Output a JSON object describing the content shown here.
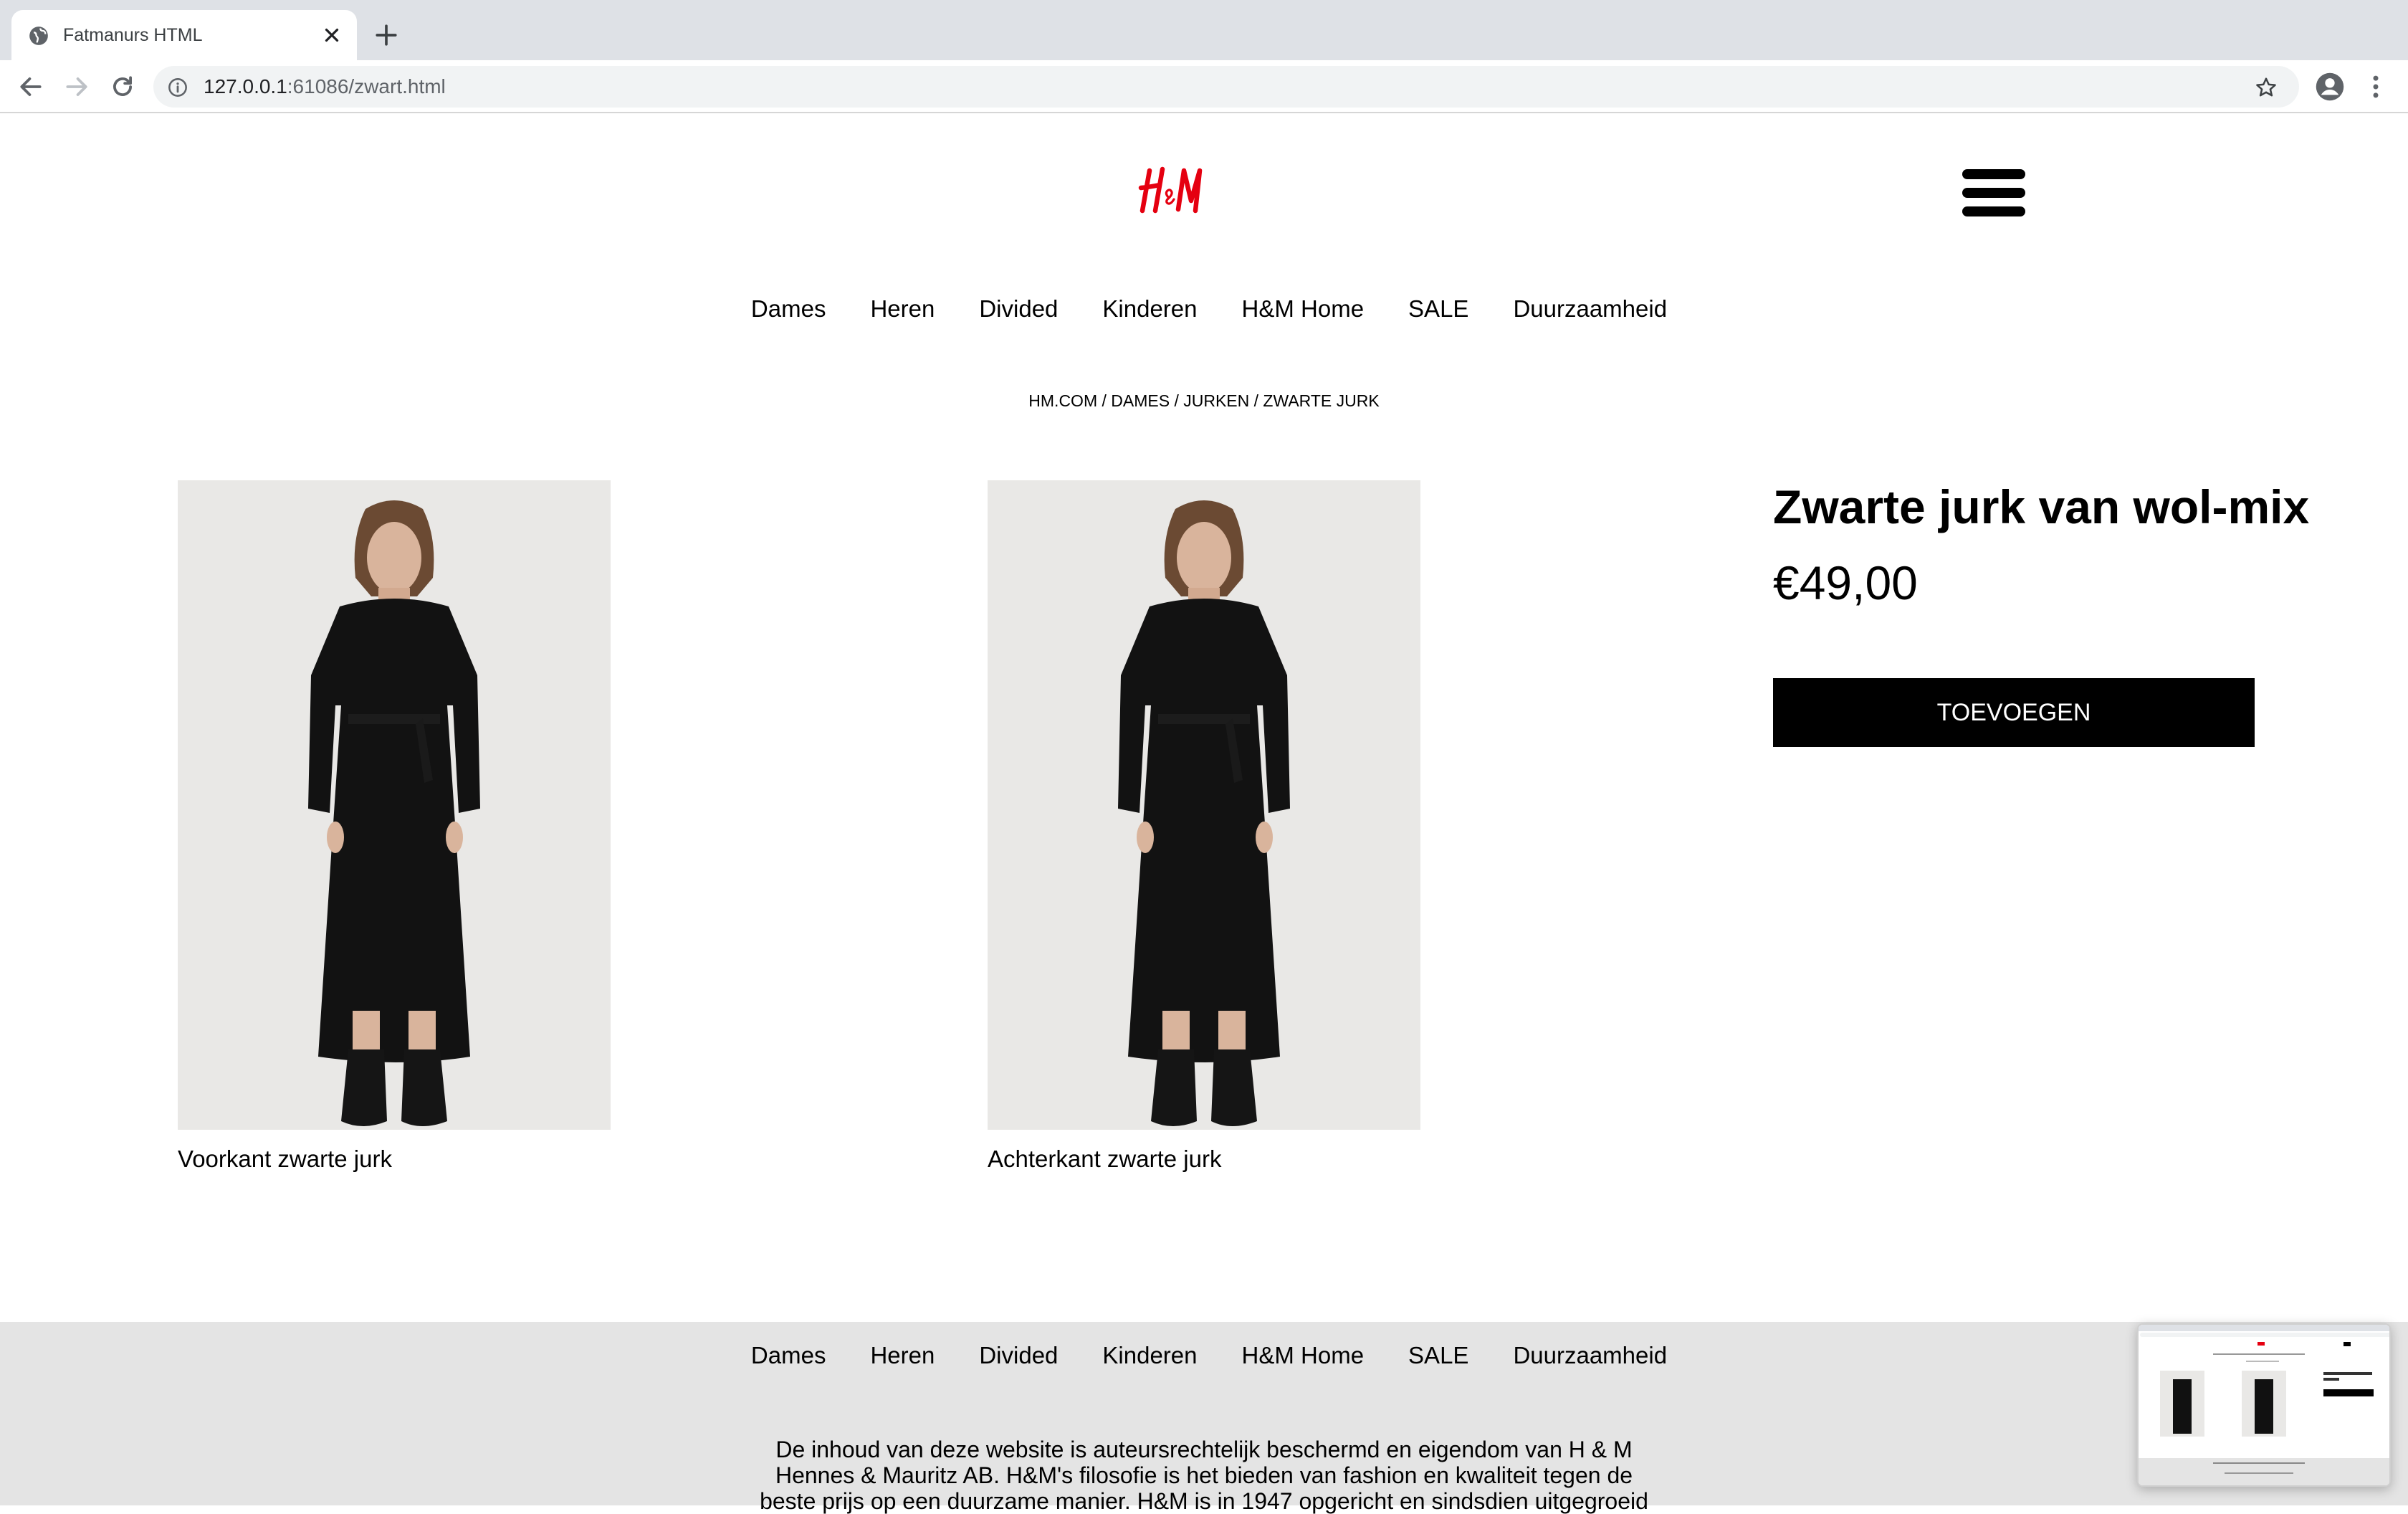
{
  "browser": {
    "tab_title": "Fatmanurs HTML",
    "url_host": "127.0.0.1",
    "url_rest": ":61086/zwart.html"
  },
  "header": {
    "logo_text": "H&M",
    "logo_color": "#e50010"
  },
  "nav": [
    "Dames",
    "Heren",
    "Divided",
    "Kinderen",
    "H&M Home",
    "SALE",
    "Duurzaamheid"
  ],
  "breadcrumb": "HM.COM / DAMES / JURKEN / ZWARTE JURK",
  "gallery": [
    {
      "caption": "Voorkant zwarte jurk"
    },
    {
      "caption": "Achterkant zwarte jurk"
    }
  ],
  "product": {
    "title": "Zwarte jurk van wol-mix",
    "price": "€49,00",
    "add_button": "TOEVOEGEN"
  },
  "footer": {
    "nav": [
      "Dames",
      "Heren",
      "Divided",
      "Kinderen",
      "H&M Home",
      "SALE",
      "Duurzaamheid"
    ],
    "text": "De inhoud van deze website is auteursrechtelijk beschermd en eigendom van H & M Hennes & Mauritz AB. H&M's filosofie is het bieden van fashion en kwaliteit tegen de beste prijs op een duurzame manier. H&M is in 1947 opgericht en sindsdien uitgegroeid"
  }
}
